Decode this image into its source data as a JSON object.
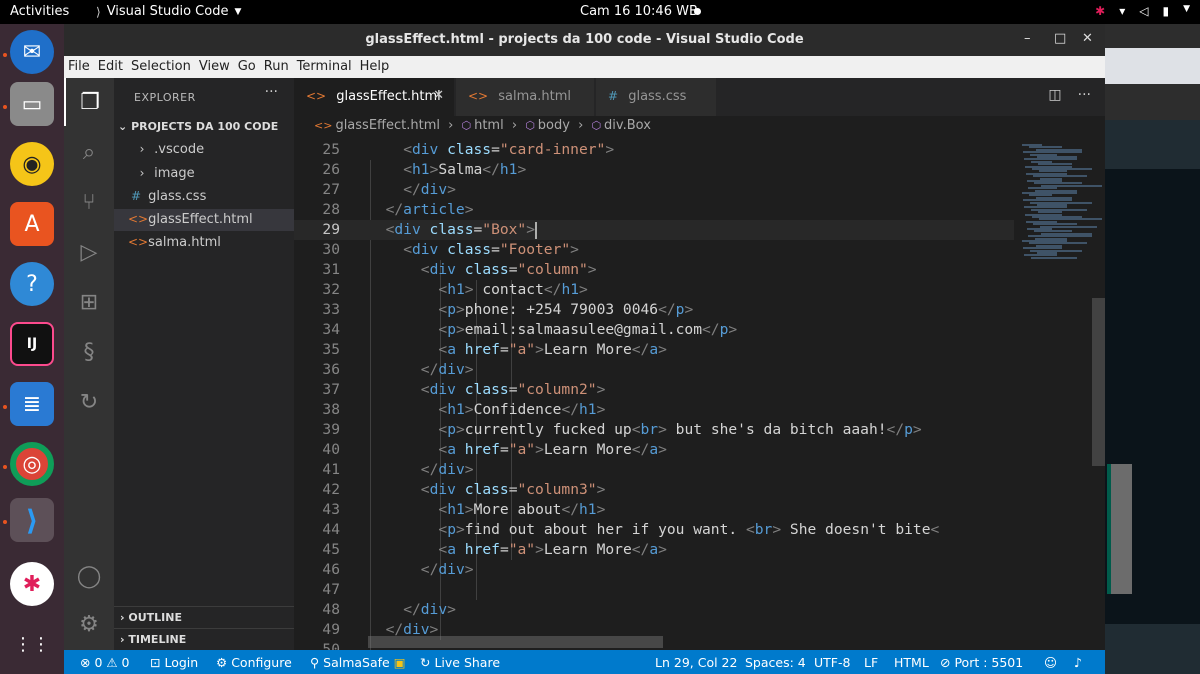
{
  "topbar": {
    "activities": "Activities",
    "app_name": "Visual Studio Code",
    "app_menu_icon": "caret-down",
    "clock": "Cam 16  10:46 WB"
  },
  "dock": {
    "items": [
      {
        "name": "thunderbird",
        "glyph": "✉"
      },
      {
        "name": "files",
        "glyph": "▭"
      },
      {
        "name": "rhythmbox",
        "glyph": "◉"
      },
      {
        "name": "ubuntu-software",
        "glyph": "A"
      },
      {
        "name": "help",
        "glyph": "?"
      },
      {
        "name": "intellij",
        "glyph": "IJ"
      },
      {
        "name": "libreoffice-writer",
        "glyph": "≣"
      },
      {
        "name": "chrome",
        "glyph": "◎"
      },
      {
        "name": "vscode",
        "glyph": "⟩"
      },
      {
        "name": "slack",
        "glyph": "✱"
      },
      {
        "name": "show-apps",
        "glyph": "⋮⋮"
      }
    ]
  },
  "window": {
    "title": "glassEffect.html - projects da 100 code - Visual Studio Code",
    "minimize": "–",
    "maximize": "□",
    "close": "✕"
  },
  "menu": [
    "File",
    "Edit",
    "Selection",
    "View",
    "Go",
    "Run",
    "Terminal",
    "Help"
  ],
  "sidebar": {
    "header": "EXPLORER",
    "more": "···",
    "project": "PROJECTS DA 100 CODE",
    "items": [
      {
        "label": ".vscode",
        "icon": "›",
        "type": "folder"
      },
      {
        "label": "image",
        "icon": "›",
        "type": "folder"
      },
      {
        "label": "glass.css",
        "icon": "#",
        "type": "css"
      },
      {
        "label": "glassEffect.html",
        "icon": "<>",
        "type": "html"
      },
      {
        "label": "salma.html",
        "icon": "<>",
        "type": "html"
      }
    ],
    "outline": "OUTLINE",
    "timeline": "TIMELINE"
  },
  "tabs": [
    {
      "label": "glassEffect.html",
      "icon": "<>",
      "active": true
    },
    {
      "label": "salma.html",
      "icon": "<>",
      "active": false
    },
    {
      "label": "glass.css",
      "icon": "#",
      "active": false
    }
  ],
  "breadcrumb": [
    "glassEffect.html",
    "html",
    "body",
    "div.Box"
  ],
  "editor": {
    "current_line": 29,
    "lines": [
      {
        "n": 25,
        "indent": 4,
        "tokens": [
          [
            "p",
            "<"
          ],
          [
            "t",
            "div"
          ],
          [
            "x",
            " "
          ],
          [
            "a",
            "class"
          ],
          [
            "x",
            "="
          ],
          [
            "s",
            "\"card-inner\""
          ],
          [
            "p",
            ">"
          ]
        ]
      },
      {
        "n": 26,
        "indent": 4,
        "tokens": [
          [
            "p",
            "<"
          ],
          [
            "t",
            "h1"
          ],
          [
            "p",
            ">"
          ],
          [
            "x",
            "Salma"
          ],
          [
            "p",
            "</"
          ],
          [
            "t",
            "h1"
          ],
          [
            "p",
            ">"
          ]
        ]
      },
      {
        "n": 27,
        "indent": 4,
        "tokens": [
          [
            "p",
            "</"
          ],
          [
            "t",
            "div"
          ],
          [
            "p",
            ">"
          ]
        ]
      },
      {
        "n": 28,
        "indent": 2,
        "tokens": [
          [
            "p",
            "</"
          ],
          [
            "t",
            "article"
          ],
          [
            "p",
            ">"
          ]
        ]
      },
      {
        "n": 29,
        "indent": 2,
        "tokens": [
          [
            "p",
            "<"
          ],
          [
            "t",
            "div"
          ],
          [
            "x",
            " "
          ],
          [
            "a",
            "class"
          ],
          [
            "x",
            "="
          ],
          [
            "s",
            "\"Box\""
          ],
          [
            "p",
            ">"
          ]
        ]
      },
      {
        "n": 30,
        "indent": 4,
        "tokens": [
          [
            "p",
            "<"
          ],
          [
            "t",
            "div"
          ],
          [
            "x",
            " "
          ],
          [
            "a",
            "class"
          ],
          [
            "x",
            "="
          ],
          [
            "s",
            "\"Footer\""
          ],
          [
            "p",
            ">"
          ]
        ]
      },
      {
        "n": 31,
        "indent": 6,
        "tokens": [
          [
            "p",
            "<"
          ],
          [
            "t",
            "div"
          ],
          [
            "x",
            " "
          ],
          [
            "a",
            "class"
          ],
          [
            "x",
            "="
          ],
          [
            "s",
            "\"column\""
          ],
          [
            "p",
            ">"
          ]
        ]
      },
      {
        "n": 32,
        "indent": 8,
        "tokens": [
          [
            "p",
            "<"
          ],
          [
            "t",
            "h1"
          ],
          [
            "p",
            ">"
          ],
          [
            "x",
            " contact"
          ],
          [
            "p",
            "</"
          ],
          [
            "t",
            "h1"
          ],
          [
            "p",
            ">"
          ]
        ]
      },
      {
        "n": 33,
        "indent": 8,
        "tokens": [
          [
            "p",
            "<"
          ],
          [
            "t",
            "p"
          ],
          [
            "p",
            ">"
          ],
          [
            "x",
            "phone: +254 79003 0046"
          ],
          [
            "p",
            "</"
          ],
          [
            "t",
            "p"
          ],
          [
            "p",
            ">"
          ]
        ]
      },
      {
        "n": 34,
        "indent": 8,
        "tokens": [
          [
            "p",
            "<"
          ],
          [
            "t",
            "p"
          ],
          [
            "p",
            ">"
          ],
          [
            "x",
            "email:salmaasulee@gmail.com"
          ],
          [
            "p",
            "</"
          ],
          [
            "t",
            "p"
          ],
          [
            "p",
            ">"
          ]
        ]
      },
      {
        "n": 35,
        "indent": 8,
        "tokens": [
          [
            "p",
            "<"
          ],
          [
            "t",
            "a"
          ],
          [
            "x",
            " "
          ],
          [
            "a",
            "href"
          ],
          [
            "x",
            "="
          ],
          [
            "s",
            "\"a\""
          ],
          [
            "p",
            ">"
          ],
          [
            "x",
            "Learn More"
          ],
          [
            "p",
            "</"
          ],
          [
            "t",
            "a"
          ],
          [
            "p",
            ">"
          ]
        ]
      },
      {
        "n": 36,
        "indent": 6,
        "tokens": [
          [
            "p",
            "</"
          ],
          [
            "t",
            "div"
          ],
          [
            "p",
            ">"
          ]
        ]
      },
      {
        "n": 37,
        "indent": 6,
        "tokens": [
          [
            "p",
            "<"
          ],
          [
            "t",
            "div"
          ],
          [
            "x",
            " "
          ],
          [
            "a",
            "class"
          ],
          [
            "x",
            "="
          ],
          [
            "s",
            "\"column2\""
          ],
          [
            "p",
            ">"
          ]
        ]
      },
      {
        "n": 38,
        "indent": 8,
        "tokens": [
          [
            "p",
            "<"
          ],
          [
            "t",
            "h1"
          ],
          [
            "p",
            ">"
          ],
          [
            "x",
            "Confidence"
          ],
          [
            "p",
            "</"
          ],
          [
            "t",
            "h1"
          ],
          [
            "p",
            ">"
          ]
        ]
      },
      {
        "n": 39,
        "indent": 8,
        "tokens": [
          [
            "p",
            "<"
          ],
          [
            "t",
            "p"
          ],
          [
            "p",
            ">"
          ],
          [
            "x",
            "currently fucked up"
          ],
          [
            "p",
            "<"
          ],
          [
            "t",
            "br"
          ],
          [
            "p",
            ">"
          ],
          [
            "x",
            " but she's da bitch aaah!"
          ],
          [
            "p",
            "</"
          ],
          [
            "t",
            "p"
          ],
          [
            "p",
            ">"
          ]
        ]
      },
      {
        "n": 40,
        "indent": 8,
        "tokens": [
          [
            "p",
            "<"
          ],
          [
            "t",
            "a"
          ],
          [
            "x",
            " "
          ],
          [
            "a",
            "href"
          ],
          [
            "x",
            "="
          ],
          [
            "s",
            "\"a\""
          ],
          [
            "p",
            ">"
          ],
          [
            "x",
            "Learn More"
          ],
          [
            "p",
            "</"
          ],
          [
            "t",
            "a"
          ],
          [
            "p",
            ">"
          ]
        ]
      },
      {
        "n": 41,
        "indent": 6,
        "tokens": [
          [
            "p",
            "</"
          ],
          [
            "t",
            "div"
          ],
          [
            "p",
            ">"
          ]
        ]
      },
      {
        "n": 42,
        "indent": 6,
        "tokens": [
          [
            "p",
            "<"
          ],
          [
            "t",
            "div"
          ],
          [
            "x",
            " "
          ],
          [
            "a",
            "class"
          ],
          [
            "x",
            "="
          ],
          [
            "s",
            "\"column3\""
          ],
          [
            "p",
            ">"
          ]
        ]
      },
      {
        "n": 43,
        "indent": 8,
        "tokens": [
          [
            "p",
            "<"
          ],
          [
            "t",
            "h1"
          ],
          [
            "p",
            ">"
          ],
          [
            "x",
            "More about"
          ],
          [
            "p",
            "</"
          ],
          [
            "t",
            "h1"
          ],
          [
            "p",
            ">"
          ]
        ]
      },
      {
        "n": 44,
        "indent": 8,
        "tokens": [
          [
            "p",
            "<"
          ],
          [
            "t",
            "p"
          ],
          [
            "p",
            ">"
          ],
          [
            "x",
            "find out about her if you want. "
          ],
          [
            "p",
            "<"
          ],
          [
            "t",
            "br"
          ],
          [
            "p",
            ">"
          ],
          [
            "x",
            " She doesn't bite"
          ],
          [
            "p",
            "<"
          ]
        ]
      },
      {
        "n": 45,
        "indent": 8,
        "tokens": [
          [
            "p",
            "<"
          ],
          [
            "t",
            "a"
          ],
          [
            "x",
            " "
          ],
          [
            "a",
            "href"
          ],
          [
            "x",
            "="
          ],
          [
            "s",
            "\"a\""
          ],
          [
            "p",
            ">"
          ],
          [
            "x",
            "Learn More"
          ],
          [
            "p",
            "</"
          ],
          [
            "t",
            "a"
          ],
          [
            "p",
            ">"
          ]
        ]
      },
      {
        "n": 46,
        "indent": 6,
        "tokens": [
          [
            "p",
            "</"
          ],
          [
            "t",
            "div"
          ],
          [
            "p",
            ">"
          ]
        ]
      },
      {
        "n": 47,
        "indent": 0,
        "tokens": []
      },
      {
        "n": 48,
        "indent": 4,
        "tokens": [
          [
            "p",
            "</"
          ],
          [
            "t",
            "div"
          ],
          [
            "p",
            ">"
          ]
        ]
      },
      {
        "n": 49,
        "indent": 2,
        "tokens": [
          [
            "p",
            "</"
          ],
          [
            "t",
            "div"
          ],
          [
            "p",
            ">"
          ]
        ]
      },
      {
        "n": 50,
        "indent": 0,
        "tokens": []
      }
    ]
  },
  "statusbar": {
    "problems": "⊗ 0 ⚠ 0",
    "login": "Login",
    "configure": "Configure",
    "salmasafe": "SalmaSafe",
    "live_share": "Live Share",
    "position": "Ln 29, Col 22",
    "spaces": "Spaces: 4",
    "encoding": "UTF-8",
    "eol": "LF",
    "language": "HTML",
    "port": "Port : 5501"
  },
  "colors": {
    "statusbar": "#007acc",
    "tag": "#569cd6",
    "attr": "#9cdcfe",
    "string": "#ce9178"
  }
}
